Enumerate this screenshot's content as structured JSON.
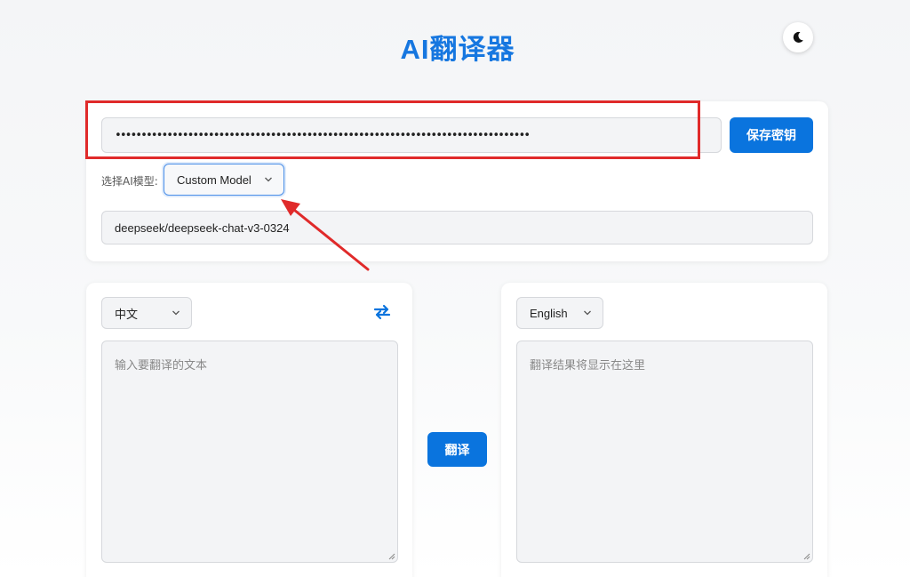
{
  "header": {
    "title": "AI翻译器",
    "theme_icon": "moon-icon"
  },
  "api_key": {
    "value": "••••••••••••••••••••••••••••••••••••••••••••••••••••••••••••••••••••••••••••••••",
    "save_label": "保存密钥"
  },
  "model": {
    "label": "选择AI模型:",
    "selected": "Custom Model",
    "custom_value": "deepseek/deepseek-chat-v3-0324"
  },
  "source": {
    "language": "中文",
    "placeholder": "输入要翻译的文本",
    "swap_icon": "swap-arrows-icon"
  },
  "target": {
    "language": "English",
    "placeholder": "翻译结果将显示在这里"
  },
  "actions": {
    "translate_label": "翻译"
  },
  "colors": {
    "accent": "#1677e0",
    "button": "#0a74de",
    "annotation": "#e02a2a"
  }
}
